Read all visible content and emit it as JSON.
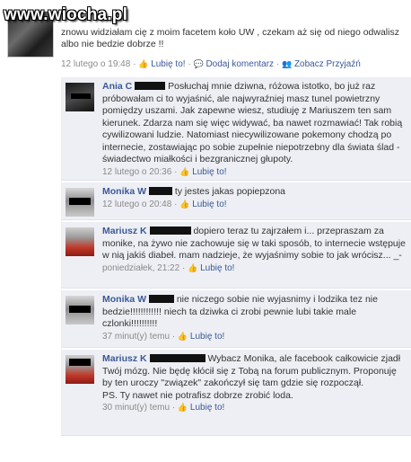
{
  "watermark": "www.wiocha.pl",
  "post": {
    "text": "znowu widziałam cię z moim facetem koło UW , czekam aż się od niego odwalisz albo nie bedzie dobrze !!",
    "time": "12 lutego o 19:48",
    "like": "Lubię to!",
    "add_comment": "Dodaj komentarz",
    "see_friendship": "Zobacz Przyjaźń"
  },
  "comments": [
    {
      "name": "Ania C",
      "text": "Posłuchaj mnie dziwna, różowa istotko, bo już raz próbowałam ci to wyjaśnić, ale najwyraźniej masz tunel powietrzny pomiędzy uszami. Jak zapewne wiesz, studiuję z Mariuszem ten sam kierunek. Zdarza nam się więc widywać, ba nawet rozmawiać! Tak robią cywilizowani ludzie. Natomiast niecywilizowane pokemony chodzą po internecie, zostawiając po sobie zupełnie niepotrzebny dla świata ślad - świadectwo miałkości i bezgranicznej głupoty.",
      "time": "12 lutego o 20:36",
      "like": "Lubię to!"
    },
    {
      "name": "Monika W",
      "text": "ty jestes jakas popiepzona",
      "time": "12 lutego o 20:48",
      "like": "Lubię to!"
    },
    {
      "name": "Mariusz K",
      "text": "dopiero teraz tu zajrzałem i... przepraszam za monike, na żywo nie zachowuje się w taki sposób, to internecie wstępuje w nią jakiś diabeł. mam nadzieje, że wyjaśnimy sobie to jak wrócisz... _-",
      "time": "poniedziałek, 21:22",
      "like": "Lubię to!"
    },
    {
      "name": "Monika W",
      "text": "nie niczego sobie nie wyjasnimy i lodzika tez nie bedzie!!!!!!!!!!!! niech ta dziwka ci zrobi pewnie lubi takie male czlonki!!!!!!!!!!",
      "time": "37 minut(y) temu",
      "like": "Lubię to!"
    },
    {
      "name": "Mariusz K",
      "text": "Wybacz Monika, ale facebook całkowicie zjadł Twój mózg. Nie będę kłócił się z Tobą na forum publicznym. Proponuję by ten uroczy \"związek\" zakończył się tam gdzie się rozpoczął.\nPS. Ty nawet nie potrafisz dobrze zrobić loda.",
      "time": "30 minut(y) temu",
      "like": "Lubię to!"
    }
  ]
}
